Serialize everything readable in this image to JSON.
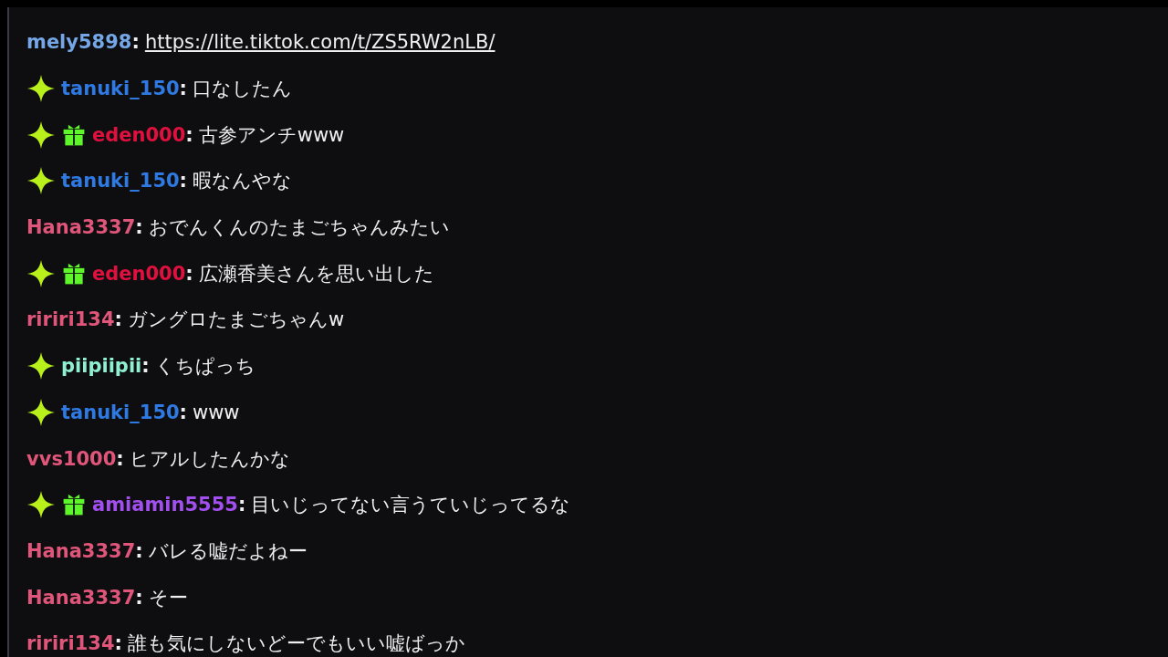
{
  "chat_messages": [
    {
      "user": "mely5898",
      "separator": ":",
      "color": "#75a7e6",
      "text": "https://lite.tiktok.com/t/ZS5RW2nLB/",
      "link": true
    },
    {
      "user": "tanuki_150",
      "separator": ":",
      "color": "#2f79e2",
      "badges": [
        {
          "kind": "sparkle"
        }
      ],
      "text": "口なしたん",
      "link": false
    },
    {
      "user": "eden000",
      "separator": ":",
      "color": "#e0103f",
      "badges": [
        {
          "kind": "sparkle"
        },
        {
          "kind": "gift"
        }
      ],
      "text": "古参アンチwww",
      "link": false
    },
    {
      "user": "tanuki_150",
      "separator": ":",
      "color": "#2f79e2",
      "badges": [
        {
          "kind": "sparkle"
        }
      ],
      "text": "暇なんやな",
      "link": false
    },
    {
      "user": "Hana3337",
      "separator": ":",
      "color": "#e0557a",
      "text": "おでんくんのたまごちゃんみたい",
      "link": false
    },
    {
      "user": "eden000",
      "separator": ":",
      "color": "#e0103f",
      "badges": [
        {
          "kind": "sparkle"
        },
        {
          "kind": "gift"
        }
      ],
      "text": "広瀬香美さんを思い出した",
      "link": false
    },
    {
      "user": "ririri134",
      "separator": ":",
      "color": "#e0557a",
      "text": "ガングロたまごちゃんw",
      "link": false
    },
    {
      "user": "piipiipii",
      "separator": ":",
      "color": "#8ff0cf",
      "badges": [
        {
          "kind": "sparkle"
        }
      ],
      "text": "くちぱっち",
      "link": false
    },
    {
      "user": "tanuki_150",
      "separator": ":",
      "color": "#2f79e2",
      "badges": [
        {
          "kind": "sparkle"
        }
      ],
      "text": "www",
      "link": false
    },
    {
      "user": "vvs1000",
      "separator": ":",
      "color": "#e0557a",
      "text": "ヒアルしたんかな",
      "link": false
    },
    {
      "user": "amiamin5555",
      "separator": ":",
      "color": "#a24ff0",
      "badges": [
        {
          "kind": "sparkle"
        },
        {
          "kind": "gift"
        }
      ],
      "text": "目いじってない言うていじってるな",
      "link": false
    },
    {
      "user": "Hana3337",
      "separator": ":",
      "color": "#e0557a",
      "text": "バレる嘘だよねー",
      "link": false
    },
    {
      "user": "Hana3337",
      "separator": ":",
      "color": "#e0557a",
      "text": "そー",
      "link": false
    },
    {
      "user": "ririri134",
      "separator": ":",
      "color": "#e0557a",
      "text": "誰も気にしないどーでもいい嘘ばっか",
      "link": false
    }
  ]
}
